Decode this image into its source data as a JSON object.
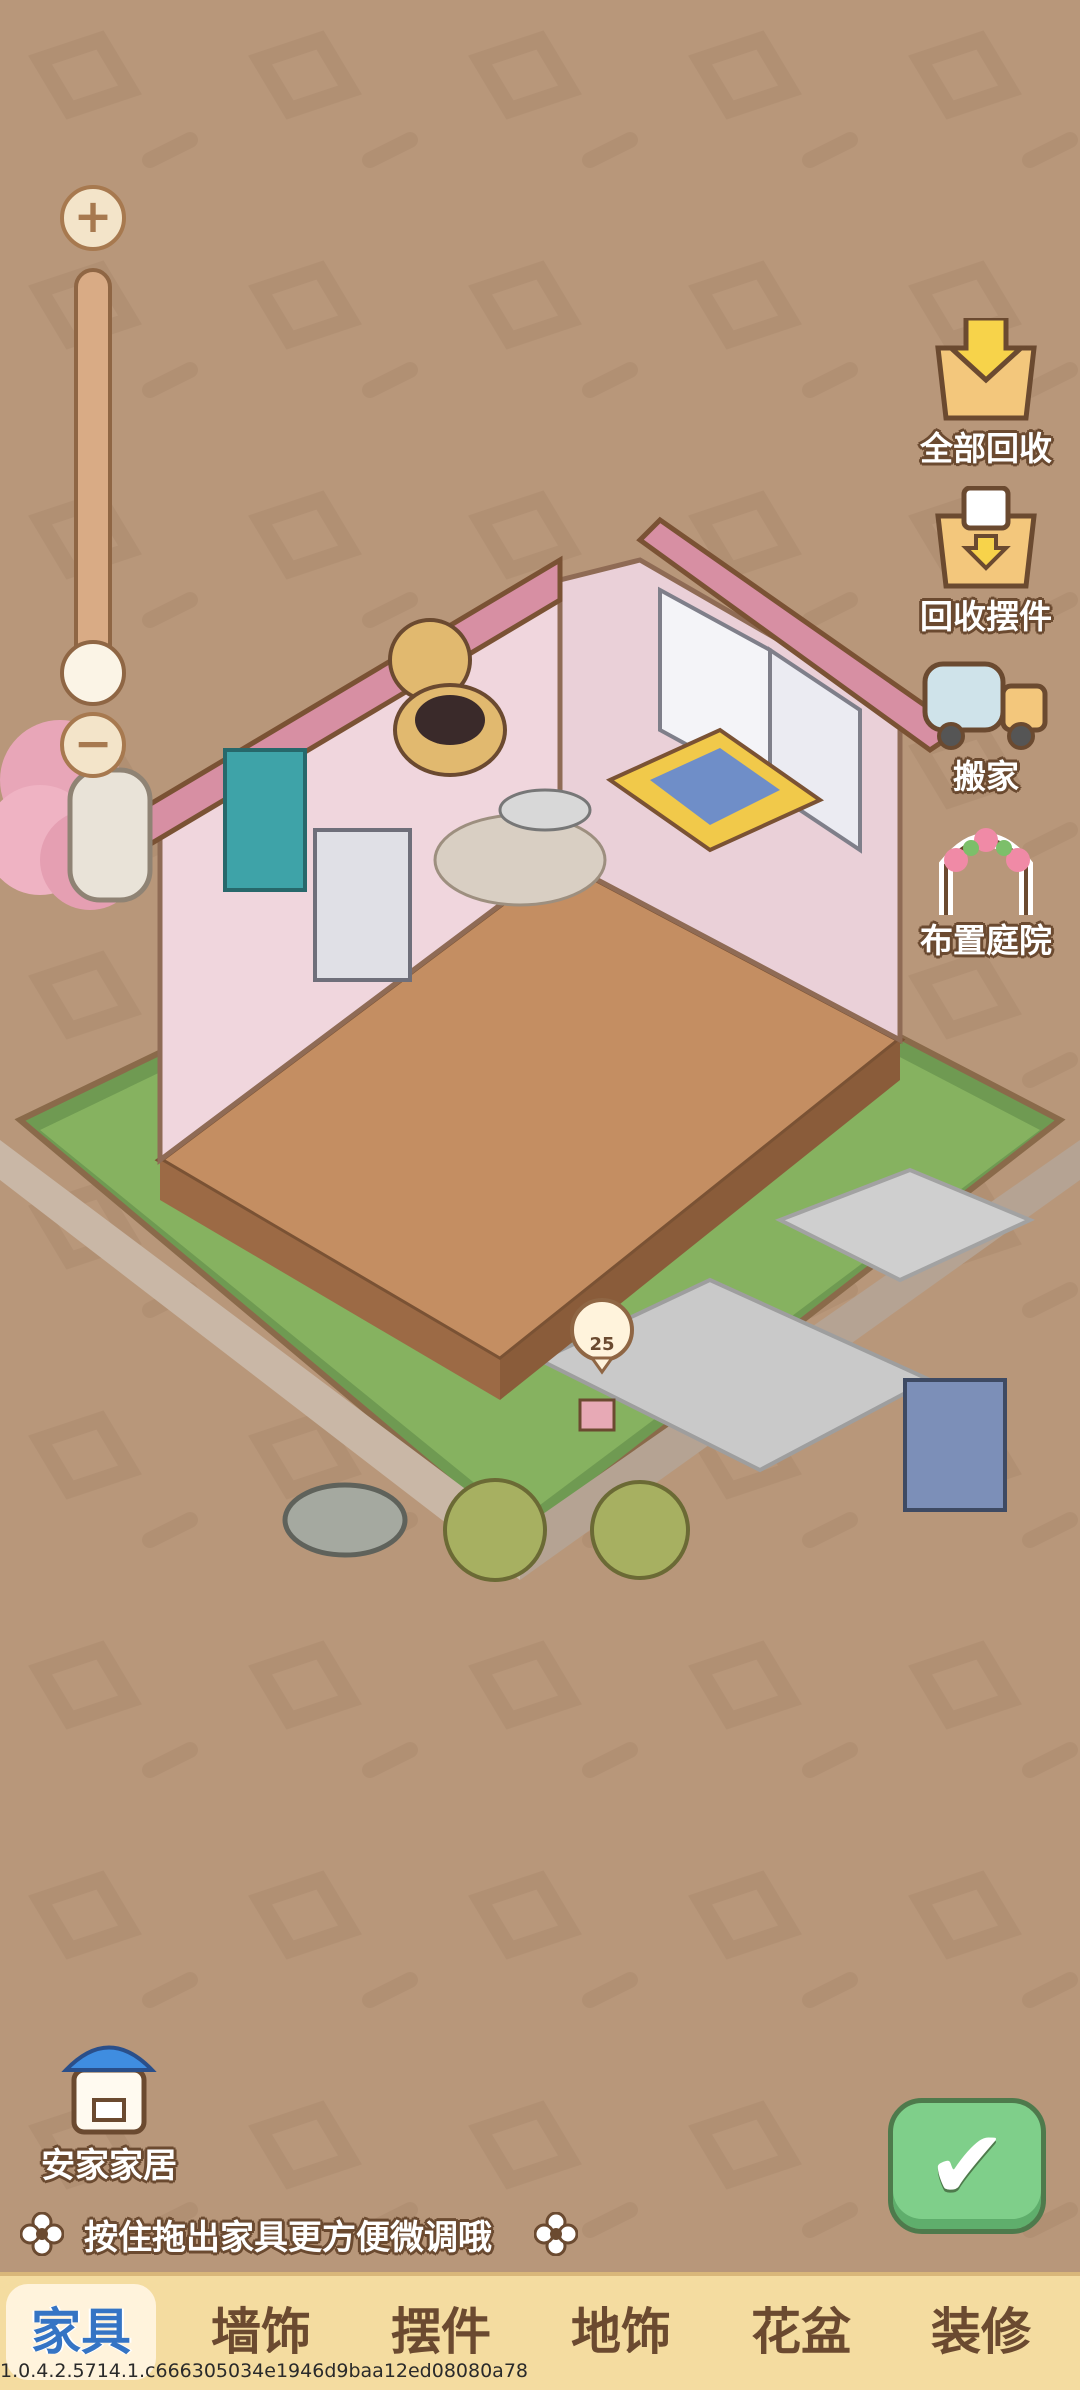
{
  "side_buttons": [
    {
      "label": "全部回收",
      "icon": "box-recycle-all-icon"
    },
    {
      "label": "回收摆件",
      "icon": "cup-recycle-icon"
    },
    {
      "label": "搬家",
      "icon": "moving-truck-icon"
    },
    {
      "label": "布置庭院",
      "icon": "garden-arch-icon"
    }
  ],
  "zoom": {
    "plus": "+",
    "minus": "−",
    "level": 0.0
  },
  "helper": {
    "label": "安家家居",
    "icon": "house-with-cap-icon"
  },
  "level_badge": "25",
  "hint": "按住拖出家具更方便微调哦",
  "tabs": [
    {
      "label": "家具",
      "active": true
    },
    {
      "label": "墙饰",
      "active": false
    },
    {
      "label": "摆件",
      "active": false
    },
    {
      "label": "地饰",
      "active": false
    },
    {
      "label": "花盆",
      "active": false
    },
    {
      "label": "装修",
      "active": false
    }
  ],
  "version": "1.0.4.2.5714.1.c666305034e1946d9baa12ed08080a78",
  "colors": {
    "background": "#b8977a",
    "tab_bar": "#f4dca0",
    "active_tab_text": "#3574c4",
    "confirm": "#7fcf8a"
  }
}
